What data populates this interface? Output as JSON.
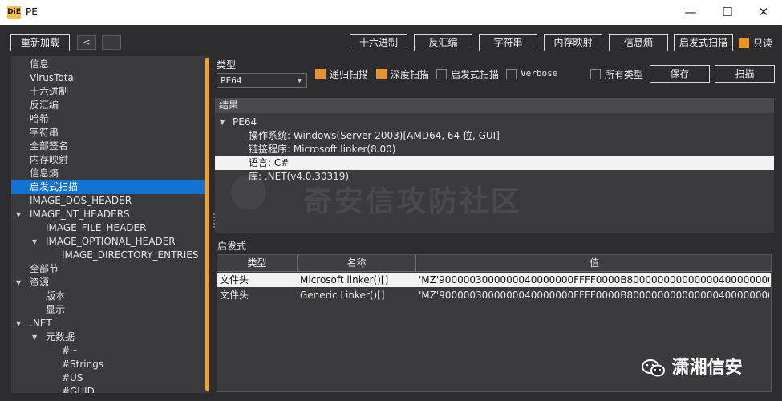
{
  "window": {
    "title": "PE",
    "icon_text": "DiE",
    "minimize": "—",
    "maximize": "☐",
    "close": "✕"
  },
  "toolbar": {
    "reload": "重新加载",
    "back": "<",
    "buttons": [
      "十六进制",
      "反汇编",
      "字符串",
      "内存映射",
      "信息熵",
      "启发式扫描"
    ],
    "readonly_label": "只读",
    "readonly_checked": true
  },
  "tree": {
    "selected_index": 9,
    "items": [
      {
        "label": "信息",
        "indent": 0,
        "arrow": ""
      },
      {
        "label": "VirusTotal",
        "indent": 0,
        "arrow": ""
      },
      {
        "label": "十六进制",
        "indent": 0,
        "arrow": ""
      },
      {
        "label": "反汇编",
        "indent": 0,
        "arrow": ""
      },
      {
        "label": "哈希",
        "indent": 0,
        "arrow": ""
      },
      {
        "label": "字符串",
        "indent": 0,
        "arrow": ""
      },
      {
        "label": "全部签名",
        "indent": 0,
        "arrow": ""
      },
      {
        "label": "内存映射",
        "indent": 0,
        "arrow": ""
      },
      {
        "label": "信息熵",
        "indent": 0,
        "arrow": ""
      },
      {
        "label": "启发式扫描",
        "indent": 0,
        "arrow": ""
      },
      {
        "label": "IMAGE_DOS_HEADER",
        "indent": 0,
        "arrow": ""
      },
      {
        "label": "IMAGE_NT_HEADERS",
        "indent": 0,
        "arrow": "▼"
      },
      {
        "label": "IMAGE_FILE_HEADER",
        "indent": 1,
        "arrow": ""
      },
      {
        "label": "IMAGE_OPTIONAL_HEADER",
        "indent": 1,
        "arrow": "▼"
      },
      {
        "label": "IMAGE_DIRECTORY_ENTRIES",
        "indent": 2,
        "arrow": ""
      },
      {
        "label": "全部节",
        "indent": 0,
        "arrow": ""
      },
      {
        "label": "资源",
        "indent": 0,
        "arrow": "▼"
      },
      {
        "label": "版本",
        "indent": 1,
        "arrow": ""
      },
      {
        "label": "显示",
        "indent": 1,
        "arrow": ""
      },
      {
        "label": ".NET",
        "indent": 0,
        "arrow": "▼"
      },
      {
        "label": "元数据",
        "indent": 1,
        "arrow": "▼"
      },
      {
        "label": "#~",
        "indent": 2,
        "arrow": ""
      },
      {
        "label": "#Strings",
        "indent": 2,
        "arrow": ""
      },
      {
        "label": "#US",
        "indent": 2,
        "arrow": ""
      },
      {
        "label": "#GUID",
        "indent": 2,
        "arrow": ""
      }
    ]
  },
  "scan": {
    "type_label": "类型",
    "type_value": "PE64",
    "options": [
      {
        "label": "递归扫描",
        "checked": true
      },
      {
        "label": "深度扫描",
        "checked": true
      },
      {
        "label": "启发式扫描",
        "checked": false
      },
      {
        "label": "Verbose",
        "checked": false
      }
    ],
    "all_types": {
      "label": "所有类型",
      "checked": false
    },
    "save": "保存",
    "scan": "扫描"
  },
  "results": {
    "header": "结果",
    "root": "PE64",
    "rows": [
      "操作系统: Windows(Server 2003)[AMD64, 64 位, GUI]",
      "链接程序: Microsoft linker(8.00)",
      "语言: C#",
      "库: .NET(v4.0.30319)"
    ],
    "highlight_index": 2
  },
  "heuristic": {
    "label": "启发式",
    "columns": [
      "类型",
      "名称",
      "值"
    ],
    "rows": [
      {
        "type": "文件头",
        "name": "Microsoft linker()[]",
        "value": "'MZ'9000003000000040000000FFFF0000B8000000000000004000000000000..."
      },
      {
        "type": "文件头",
        "name": "Generic Linker()[]",
        "value": "'MZ'9000003000000040000000FFFF0000B8000000000000004000000000000..."
      }
    ],
    "selected_index": 0
  },
  "watermark": {
    "text": "奇安信攻防社区",
    "brand": "潇湘信安"
  },
  "colors": {
    "accent": "#e8922a",
    "selection": "#1473d0",
    "background": "#2d2d30",
    "panel": "#3b3b3e"
  }
}
